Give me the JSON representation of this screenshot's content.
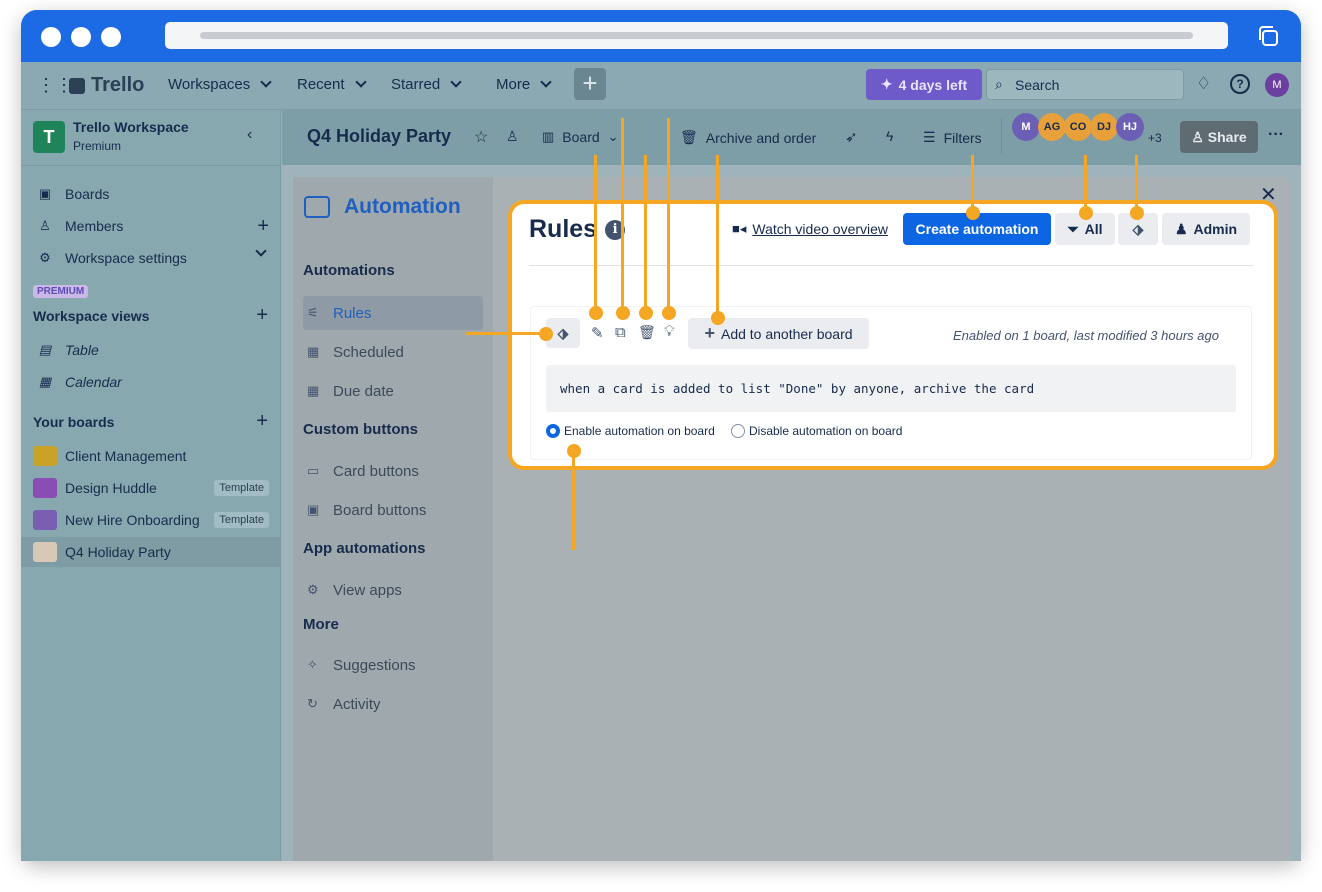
{
  "browser": {
    "url_text": ""
  },
  "topnav": {
    "logo": "Trello",
    "workspaces": "Workspaces",
    "recent": "Recent",
    "starred": "Starred",
    "more": "More",
    "trial": "4 days left",
    "search_placeholder": "Search",
    "avatar": "M"
  },
  "sidebar": {
    "workspace_initial": "T",
    "workspace_name": "Trello Workspace",
    "workspace_plan": "Premium",
    "items": [
      {
        "label": "Boards",
        "icon": "board-icon"
      },
      {
        "label": "Members",
        "icon": "person-icon"
      },
      {
        "label": "Workspace settings",
        "icon": "gear-icon"
      }
    ],
    "premium_badge": "PREMIUM",
    "views_heading": "Workspace views",
    "views": [
      {
        "label": "Table",
        "icon": "table-icon"
      },
      {
        "label": "Calendar",
        "icon": "calendar-icon"
      }
    ],
    "boards_heading": "Your boards",
    "boards": [
      {
        "label": "Client Management",
        "badge": "",
        "color": "#c9a227"
      },
      {
        "label": "Design Huddle",
        "badge": "Template",
        "color": "#8a4db3"
      },
      {
        "label": "New Hire Onboarding",
        "badge": "Template",
        "color": "#7a5fb0"
      },
      {
        "label": "Q4 Holiday Party",
        "badge": "",
        "color": "#d8c8b8"
      }
    ]
  },
  "board": {
    "title": "Q4 Holiday Party",
    "view": "Board",
    "archive": "Archive and order",
    "filters": "Filters",
    "members": [
      {
        "initials": "M",
        "color": "#6b5fb5"
      },
      {
        "initials": "AG",
        "color": "#e8a13a"
      },
      {
        "initials": "CO",
        "color": "#e8a13a"
      },
      {
        "initials": "DJ",
        "color": "#e8a13a"
      },
      {
        "initials": "HJ",
        "color": "#6b5fb5"
      }
    ],
    "more_members": "+3",
    "share": "Share"
  },
  "automation": {
    "title": "Automation",
    "sections": [
      {
        "heading": "Automations",
        "items": [
          "Rules",
          "Scheduled",
          "Due date"
        ]
      },
      {
        "heading": "Custom buttons",
        "items": [
          "Card buttons",
          "Board buttons"
        ]
      },
      {
        "heading": "App automations",
        "items": [
          "View apps"
        ]
      },
      {
        "heading": "More",
        "items": [
          "Suggestions",
          "Activity"
        ]
      }
    ]
  },
  "rules": {
    "title": "Rules",
    "watch_video": "Watch video overview",
    "create_button": "Create automation",
    "filter_all": "All",
    "admin": "Admin",
    "add_board_button": "Add to another board",
    "status_text": "Enabled on 1 board, last modified 3 hours ago",
    "rule_text": "when a card is added to list \"Done\" by anyone, archive the card",
    "enable_label": "Enable automation on board",
    "disable_label": "Disable automation on board",
    "enabled": true
  },
  "colors": {
    "accent": "#0c66e4",
    "callout": "#f5a623",
    "titlebar": "#1c6ae4"
  }
}
